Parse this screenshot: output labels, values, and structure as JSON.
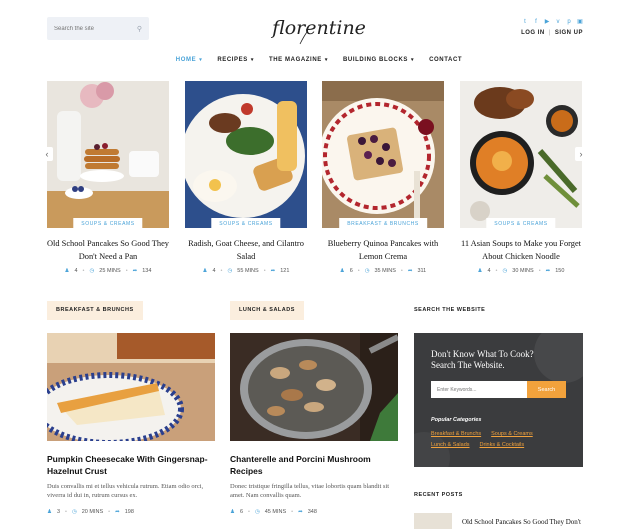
{
  "header": {
    "search_placeholder": "Search the site",
    "logo_text": "florentine",
    "social_icons": [
      "twitter-icon",
      "facebook-icon",
      "youtube-icon",
      "vimeo-icon",
      "pinterest-icon",
      "instagram-icon"
    ],
    "login": "LOG IN",
    "signup": "SIGN UP"
  },
  "nav": {
    "items": [
      {
        "label": "HOME",
        "active": true
      },
      {
        "label": "RECIPES"
      },
      {
        "label": "THE MAGAZINE"
      },
      {
        "label": "BUILDING BLOCKS"
      },
      {
        "label": "CONTACT"
      }
    ]
  },
  "slider": {
    "items": [
      {
        "category": "SOUPS & CREAMS",
        "title": "Old School Pancakes So Good They Don't Need a Pan",
        "people": "4",
        "time": "25 MINS",
        "shares": "134"
      },
      {
        "category": "SOUPS & CREAMS",
        "title": "Radish, Goat Cheese, and Cilantro Salad",
        "people": "4",
        "time": "55 MINS",
        "shares": "121"
      },
      {
        "category": "BREAKFAST & BRUNCHS",
        "title": "Blueberry Quinoa Pancakes with Lemon Crema",
        "people": "6",
        "time": "35 MINS",
        "shares": "311"
      },
      {
        "category": "SOUPS & CREAMS",
        "title": "11 Asian Soups to Make you Forget About Chicken Noodle",
        "people": "4",
        "time": "30 MINS",
        "shares": "150"
      }
    ]
  },
  "sections": {
    "breakfast_label": "BREAKFAST & BRUNCHS",
    "lunch_label": "LUNCH & SALADS"
  },
  "posts": [
    {
      "title": "Pumpkin Cheesecake With Gingersnap-Hazelnut Crust",
      "excerpt": "Duis convallis mi et tellus vehicula rutrum. Etiam odio orci, viverra id dui in, rutrum cursus ex.",
      "people": "3",
      "time": "20 MINS",
      "shares": "198"
    },
    {
      "title": "Chanterelle and Porcini Mushroom Recipes",
      "excerpt": "Donec tristique fringilla tellus, vitae lobortis quam blandit sit amet. Nam convallis quam.",
      "people": "6",
      "time": "45 MINS",
      "shares": "348"
    }
  ],
  "sidebar": {
    "search_title": "SEARCH THE WEBSITE",
    "cta_heading_1": "Don't Know What To Cook?",
    "cta_heading_2": "Search The Website.",
    "cta_placeholder": "Enter Keywords...",
    "cta_button": "Search",
    "popular_label": "Popular Categories",
    "categories": [
      "Breakfast & Brunchs",
      "Soups & Creams",
      "Lunch & Salads",
      "Drinks & Cocktails"
    ],
    "recent_title": "RECENT POSTS",
    "recent_post": "Old School Pancakes So Good They Don't"
  },
  "colors": {
    "accent": "#4aa3d8",
    "orange": "#f2a23c",
    "label_bg": "#fbeede"
  }
}
